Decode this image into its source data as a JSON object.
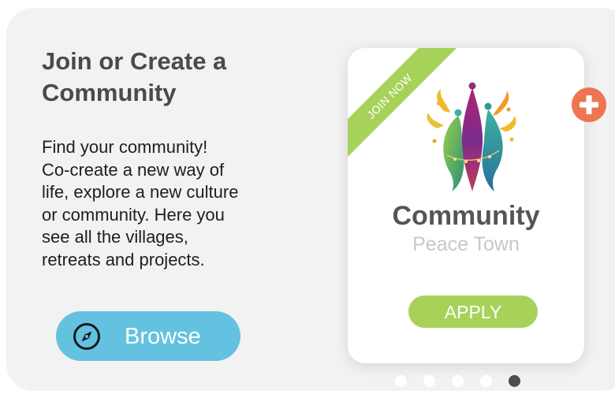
{
  "section": {
    "title": "Join or Create a\nCommunity",
    "description": "Find your community!\nCo-create a new way of\nlife, explore a new culture\nor community. Here you\nsee all the villages,\nretreats and projects."
  },
  "browse_button": {
    "label": "Browse",
    "icon": "compass-icon",
    "color": "#63c2e0"
  },
  "card": {
    "ribbon_label": "JOIN NOW",
    "logo": "community-logo",
    "title": "Community",
    "subtitle": "Peace Town",
    "apply_label": "APPLY",
    "accent_color": "#a6d25a"
  },
  "add_button": {
    "icon": "plus-icon",
    "color": "#ee7552"
  },
  "carousel": {
    "total": 5,
    "active_index": 4
  }
}
